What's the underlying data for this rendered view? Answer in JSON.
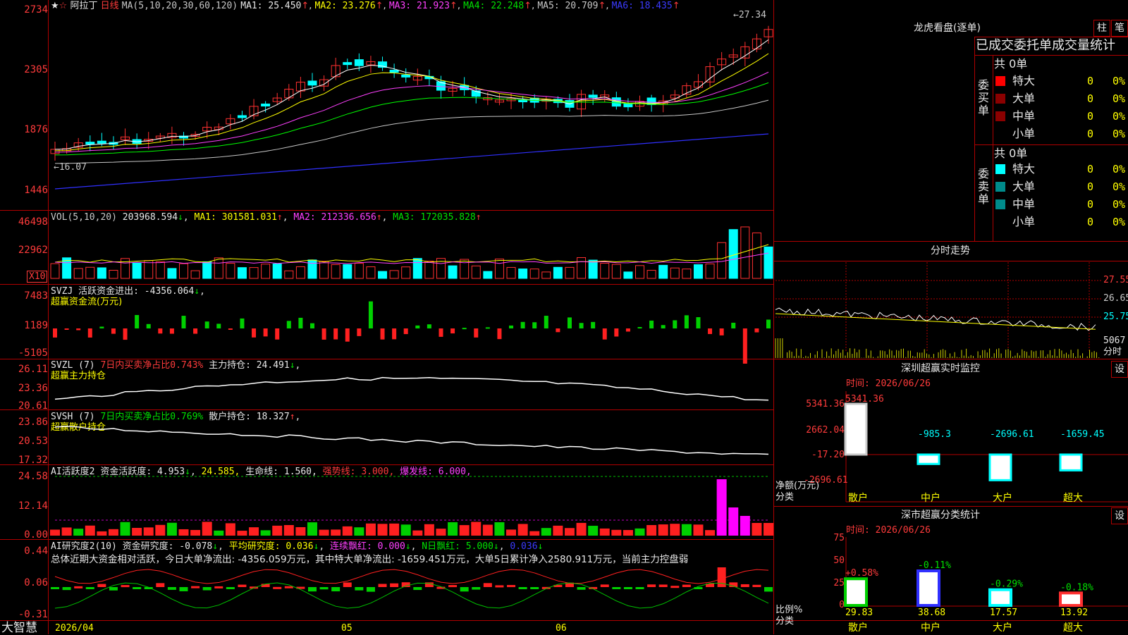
{
  "stock": {
    "name": "阿拉丁",
    "period": "日线",
    "star": "★",
    "fav": "☆"
  },
  "ma_header": {
    "label": "MA(5,10,20,30,60,120)",
    "ma1": "MA1: 25.450",
    "ma2": "MA2: 23.276",
    "ma3": "MA3: 21.923",
    "ma4": "MA4: 22.248",
    "ma5": "MA5: 20.709",
    "ma6": "MA6: 18.435",
    "arrow_down": "↓",
    "arrow_up": "↑"
  },
  "price_axis": [
    "2734",
    "2305",
    "1876",
    "1446"
  ],
  "price_annot": {
    "high": "27.34",
    "low": "16.07"
  },
  "vol_header": {
    "label": "VOL(5,10,20)",
    "val": "203968.594",
    "ma1": "MA1: 301581.031",
    "ma2": "MA2: 212336.656",
    "ma3": "MA3: 172035.828"
  },
  "vol_axis": [
    "46498",
    "22962"
  ],
  "vol_unit": "X10",
  "svzj": {
    "title": "SVZJ  活跃资金进出: -4356.064",
    "sub": "超赢资金流(万元)",
    "axis": [
      "7483",
      "1189",
      "-5105"
    ]
  },
  "svzl": {
    "title": "SVZL (7)",
    "part2": "7日内买卖净占比0.743%",
    "part3": "主力持仓: 24.491",
    "sub": "超赢主力持仓",
    "axis": [
      "26.11",
      "23.36",
      "20.61"
    ]
  },
  "svsh": {
    "title": "SVSH (7)",
    "part2": "7日内买卖净占比0.769%",
    "part3": "散户持仓: 18.327",
    "sub": "超赢散户持仓",
    "axis": [
      "23.86",
      "20.53",
      "17.32"
    ]
  },
  "ai2": {
    "title": "AI活跃度2",
    "p1": "资金活跃度: 4.953",
    "p2": "24.585,",
    "p3": "生命线: 1.560,",
    "p4": "强势线: 3.000,",
    "p5": "爆发线: 6.000,",
    "axis": [
      "24.58",
      "12.14",
      "0.00"
    ]
  },
  "aiyj": {
    "title": "AI研究度2(10)",
    "p1": "资金研究度: -0.078",
    "p2": "平均研究度: 0.036",
    "p3": "连续飘红: 0.000",
    "p4": "N日飘红: 5.000",
    "p5": "0.036",
    "note": "总体近期大资金相对活跃，今日大单净流出: -4356.059万元，其中特大单净流出: -1659.451万元，大单5日累计净入2580.911万元，当前主力控盘弱",
    "axis": [
      "0.44",
      "0.06",
      "-0.31"
    ]
  },
  "bottom": {
    "brand": "大智慧",
    "date": "2026/04",
    "m5": "05",
    "m6": "06"
  },
  "lhb": {
    "title": "龙虎看盘(逐单)",
    "btn1": "柱",
    "btn2": "笔",
    "header": "已成交委托单成交量统计",
    "buy_total": "共 0单",
    "buy_label": "委买单",
    "sell_total": "共 0单",
    "sell_label": "委卖单",
    "rows": [
      "特大",
      "大单",
      "中单",
      "小单"
    ],
    "zero": "0",
    "pct": "0%",
    "buy_colors": [
      "#ff0000",
      "#8b0000",
      "#8b0000",
      "#000000"
    ],
    "sell_colors": [
      "#00ffff",
      "#008b8b",
      "#008b8b",
      "#000000"
    ]
  },
  "fs": {
    "title": "分时走势",
    "axis": [
      "27.55",
      "26.65",
      "25.75"
    ],
    "vol_label": "5067",
    "sub": "分时"
  },
  "sz1": {
    "title": "深圳超赢实时监控",
    "btn": "设",
    "time": "时间: 2026/06/26",
    "axis": [
      "5341.36",
      "2662.04",
      "-17.20",
      "-2696.61"
    ],
    "ylab": "净额(万元)",
    "xlab": "分类",
    "cats": [
      "散户",
      "中户",
      "大户",
      "超大"
    ],
    "values": [
      5341.36,
      -985.3,
      -2696.61,
      -1659.45
    ],
    "labels": [
      "5341.36",
      "-985.3",
      "-2696.61",
      "-1659.45"
    ]
  },
  "sz2": {
    "title": "深市超赢分类统计",
    "btn": "设",
    "time": "时间: 2026/06/26",
    "axis": [
      "75",
      "50",
      "25",
      "0"
    ],
    "ylab": "比例%",
    "xlab": "分类",
    "cats": [
      "散户",
      "中户",
      "大户",
      "超大"
    ],
    "values": [
      29.83,
      38.68,
      17.57,
      13.92
    ],
    "pct": [
      "+0.58%",
      "-0.11%",
      "-0.29%",
      "-0.18%"
    ]
  }
}
